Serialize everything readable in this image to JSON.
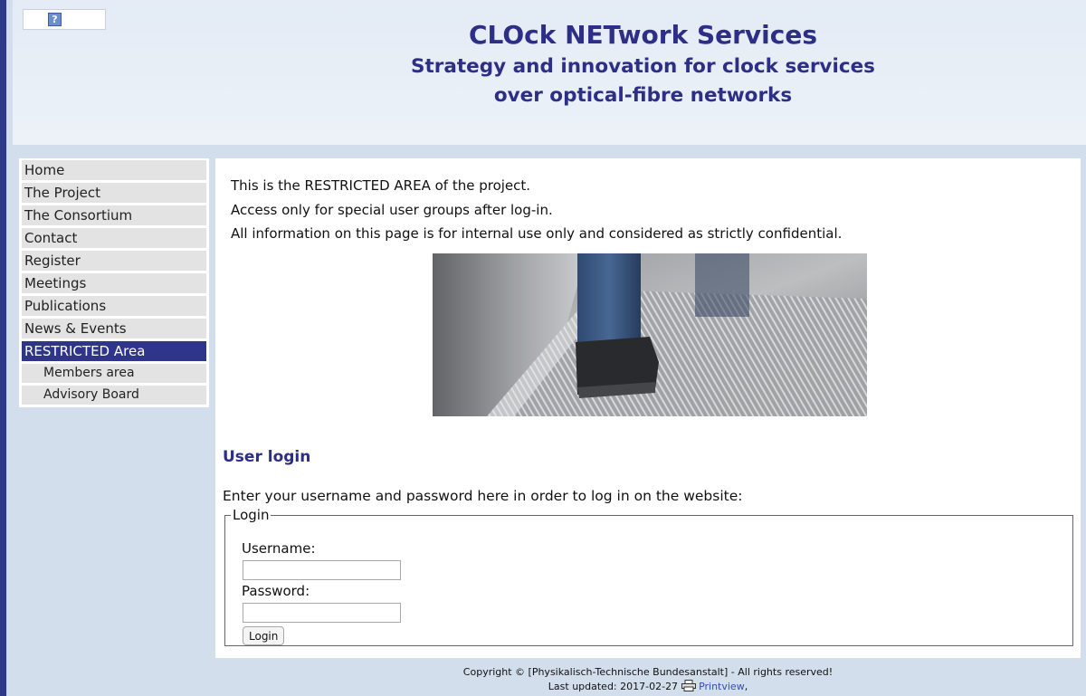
{
  "header": {
    "title": "CLOck NETwork Services",
    "subtitle_line1": "Strategy and innovation for clock services",
    "subtitle_line2": "over optical-fibre networks",
    "logo_glyph": "?"
  },
  "sidebar": {
    "items": [
      {
        "label": "Home"
      },
      {
        "label": "The Project"
      },
      {
        "label": "The Consortium"
      },
      {
        "label": "Contact"
      },
      {
        "label": "Register"
      },
      {
        "label": "Meetings"
      },
      {
        "label": "Publications"
      },
      {
        "label": "News & Events"
      },
      {
        "label": "RESTRICTED Area",
        "active": true
      },
      {
        "label": "Members area",
        "sub": true
      },
      {
        "label": "Advisory Board",
        "sub": true
      }
    ]
  },
  "main": {
    "intro_lines": [
      "This is the RESTRICTED AREA of the project.",
      "Access only for special user groups after log-in.",
      "All information on this page is for internal use only and considered as strictly confidential."
    ],
    "login": {
      "heading": "User login",
      "instructions": "Enter your username and password here in order to log in on the website:",
      "legend": "Login",
      "username_label": "Username:",
      "username_value": "",
      "password_label": "Password:",
      "password_value": "",
      "button_label": "Login"
    }
  },
  "footer": {
    "copyright": "Copyright © [Physikalisch-Technische Bundesanstalt] - All rights reserved!",
    "last_updated": "Last updated: 2017-02-27",
    "printview_label": "Printview",
    "printview_suffix": ","
  },
  "colors": {
    "brand": "#2d2e85",
    "active_nav": "#2f358a",
    "page_bg": "#d2deeb",
    "nav_item_bg": "#e3e3e3",
    "link": "#2f4fb0"
  }
}
